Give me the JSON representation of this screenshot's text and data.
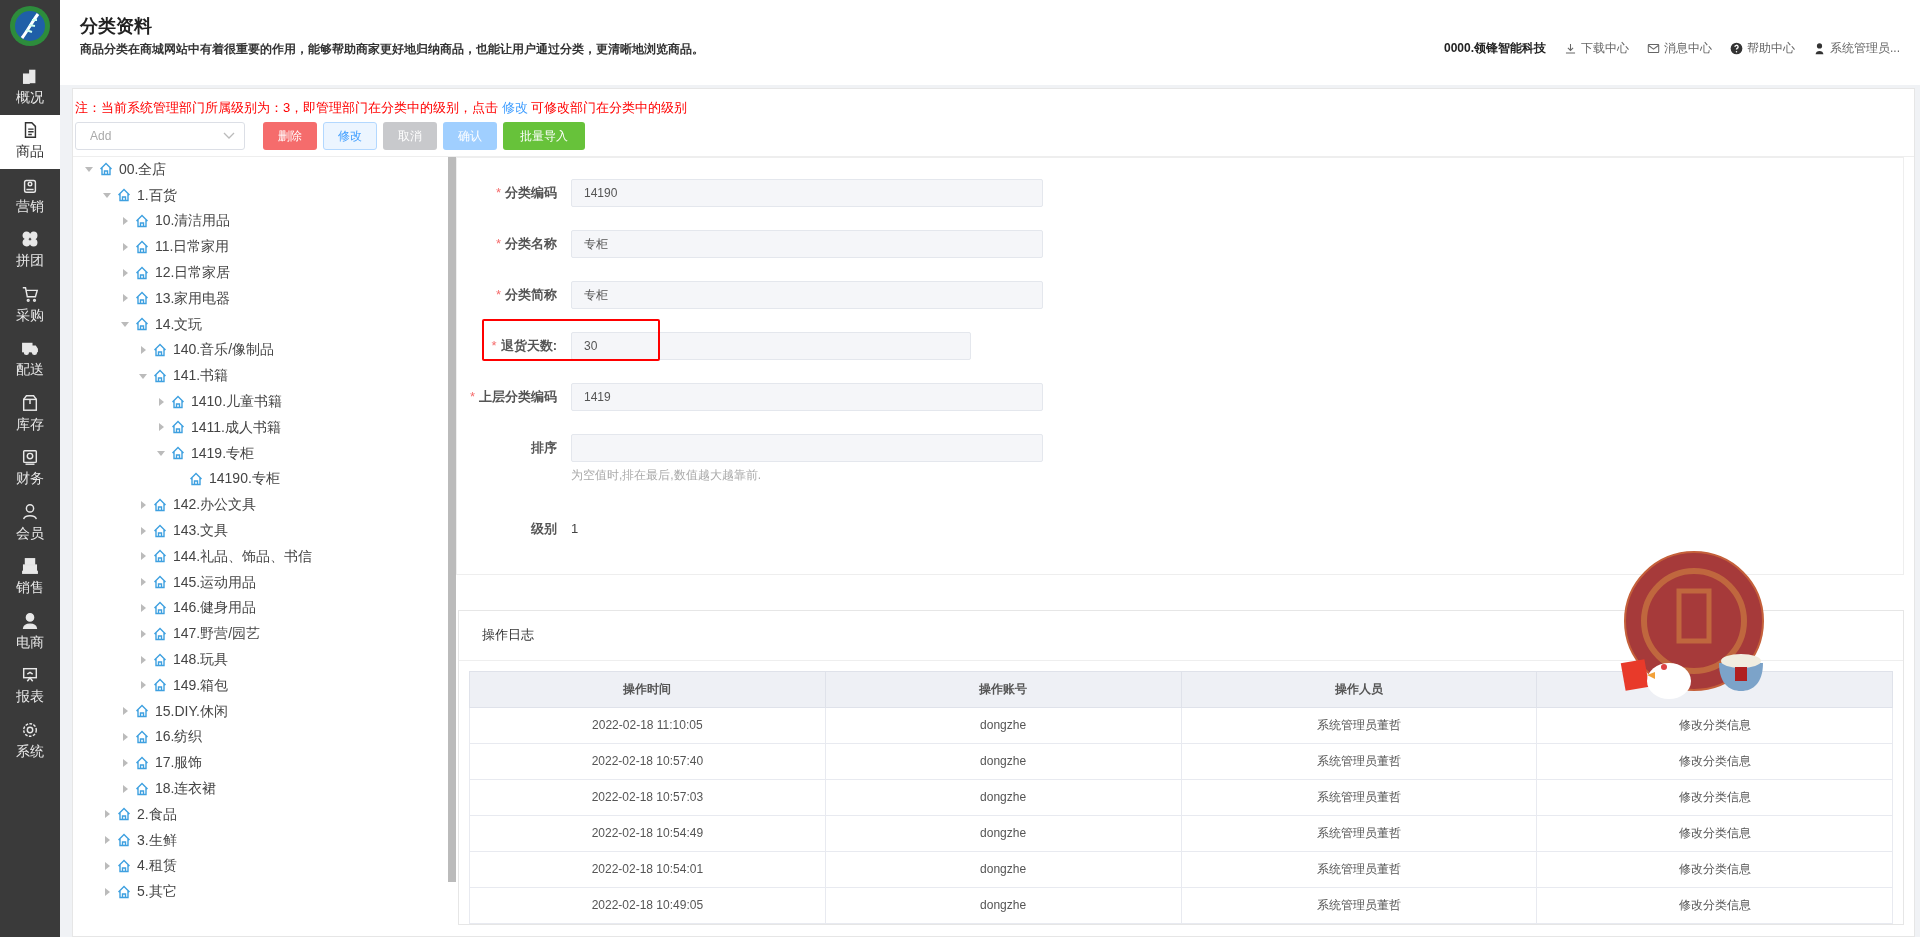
{
  "sidebar": {
    "items": [
      {
        "label": "概况",
        "selected": false
      },
      {
        "label": "商品",
        "selected": true
      },
      {
        "label": "营销",
        "selected": false
      },
      {
        "label": "拼团",
        "selected": false
      },
      {
        "label": "采购",
        "selected": false
      },
      {
        "label": "配送",
        "selected": false
      },
      {
        "label": "库存",
        "selected": false
      },
      {
        "label": "财务",
        "selected": false
      },
      {
        "label": "会员",
        "selected": false
      },
      {
        "label": "销售",
        "selected": false
      },
      {
        "label": "电商",
        "selected": false
      },
      {
        "label": "报表",
        "selected": false
      },
      {
        "label": "系统",
        "selected": false
      }
    ]
  },
  "header": {
    "title": "分类资料",
    "subtitle": "商品分类在商城网站中有着很重要的作用，能够帮助商家更好地归纳商品，也能让用户通过分类，更清晰地浏览商品。",
    "company": "0000.领锋智能科技",
    "links": [
      {
        "kind": "download",
        "label": "下载中心"
      },
      {
        "kind": "mail",
        "label": "消息中心"
      },
      {
        "kind": "help",
        "label": "帮助中心"
      },
      {
        "kind": "user",
        "label": "系统管理员..."
      }
    ]
  },
  "notice": {
    "before": "注：当前系统管理部门所属级别为：3，即管理部门在分类中的级别，点击",
    "link": "修改",
    "after": "可修改部门在分类中的级别"
  },
  "toolbar": {
    "select": {
      "placeholder": "Add"
    },
    "buttons": [
      {
        "kind": "danger",
        "label": "删除"
      },
      {
        "kind": "edit",
        "label": "修改"
      },
      {
        "kind": "cancel",
        "label": "取消"
      },
      {
        "kind": "confirm",
        "label": "确认"
      },
      {
        "kind": "success",
        "label": "批量导入"
      }
    ]
  },
  "tree": [
    {
      "label": "00.全店",
      "expanded": true,
      "children": [
        {
          "label": "1.百货",
          "expanded": true,
          "children": [
            {
              "label": "10.清洁用品",
              "expanded": false
            },
            {
              "label": "11.日常家用",
              "expanded": false
            },
            {
              "label": "12.日常家居",
              "expanded": false
            },
            {
              "label": "13.家用电器",
              "expanded": false
            },
            {
              "label": "14.文玩",
              "expanded": true,
              "children": [
                {
                  "label": "140.音乐/像制品",
                  "expanded": false
                },
                {
                  "label": "141.书籍",
                  "expanded": true,
                  "children": [
                    {
                      "label": "1410.儿童书籍",
                      "expanded": false
                    },
                    {
                      "label": "1411.成人书籍",
                      "expanded": false
                    },
                    {
                      "label": "1419.专柜",
                      "expanded": true,
                      "children": [
                        {
                          "label": "14190.专柜"
                        }
                      ]
                    }
                  ]
                },
                {
                  "label": "142.办公文具",
                  "expanded": false
                },
                {
                  "label": "143.文具",
                  "expanded": false
                },
                {
                  "label": "144.礼品、饰品、书信",
                  "expanded": false
                },
                {
                  "label": "145.运动用品",
                  "expanded": false
                },
                {
                  "label": "146.健身用品",
                  "expanded": false
                },
                {
                  "label": "147.野营/园艺",
                  "expanded": false
                },
                {
                  "label": "148.玩具",
                  "expanded": false
                },
                {
                  "label": "149.箱包",
                  "expanded": false
                }
              ]
            },
            {
              "label": "15.DIY.休闲",
              "expanded": false
            },
            {
              "label": "16.纺织",
              "expanded": false
            },
            {
              "label": "17.服饰",
              "expanded": false
            },
            {
              "label": "18.连衣裙",
              "expanded": false
            }
          ]
        },
        {
          "label": "2.食品",
          "expanded": false
        },
        {
          "label": "3.生鲜",
          "expanded": false
        },
        {
          "label": "4.租赁",
          "expanded": false
        },
        {
          "label": "5.其它",
          "expanded": false
        }
      ]
    }
  ],
  "form": {
    "fields": [
      {
        "marker": "*",
        "label": "分类编码",
        "value": "14190"
      },
      {
        "marker": "*",
        "label": "分类名称",
        "value": "专柜"
      },
      {
        "marker": "*",
        "label": "分类简称",
        "value": "专柜"
      },
      {
        "marker": "*",
        "label": "退货天数:",
        "value": "30",
        "highlighted": true
      },
      {
        "marker": "*",
        "label": "上层分类编码",
        "value": "1419"
      },
      {
        "label": "排序",
        "hint": "为空值时,排在最后,数值越大越靠前."
      }
    ],
    "level": {
      "label": "级别",
      "value": "1"
    }
  },
  "log": {
    "title": "操作日志",
    "table": {
      "columns": [
        "操作时间",
        "操作账号",
        "操作人员"
      ],
      "rows": [
        [
          "2022-02-18 11:10:05",
          "dongzhe",
          "系统管理员董哲",
          "修改分类信息"
        ],
        [
          "2022-02-18 10:57:40",
          "dongzhe",
          "系统管理员董哲",
          "修改分类信息"
        ],
        [
          "2022-02-18 10:57:03",
          "dongzhe",
          "系统管理员董哲",
          "修改分类信息"
        ],
        [
          "2022-02-18 10:54:49",
          "dongzhe",
          "系统管理员董哲",
          "修改分类信息"
        ],
        [
          "2022-02-18 10:54:01",
          "dongzhe",
          "系统管理员董哲",
          "修改分类信息"
        ],
        [
          "2022-02-18 10:49:05",
          "dongzhe",
          "系统管理员董哲",
          "修改分类信息"
        ]
      ]
    }
  }
}
